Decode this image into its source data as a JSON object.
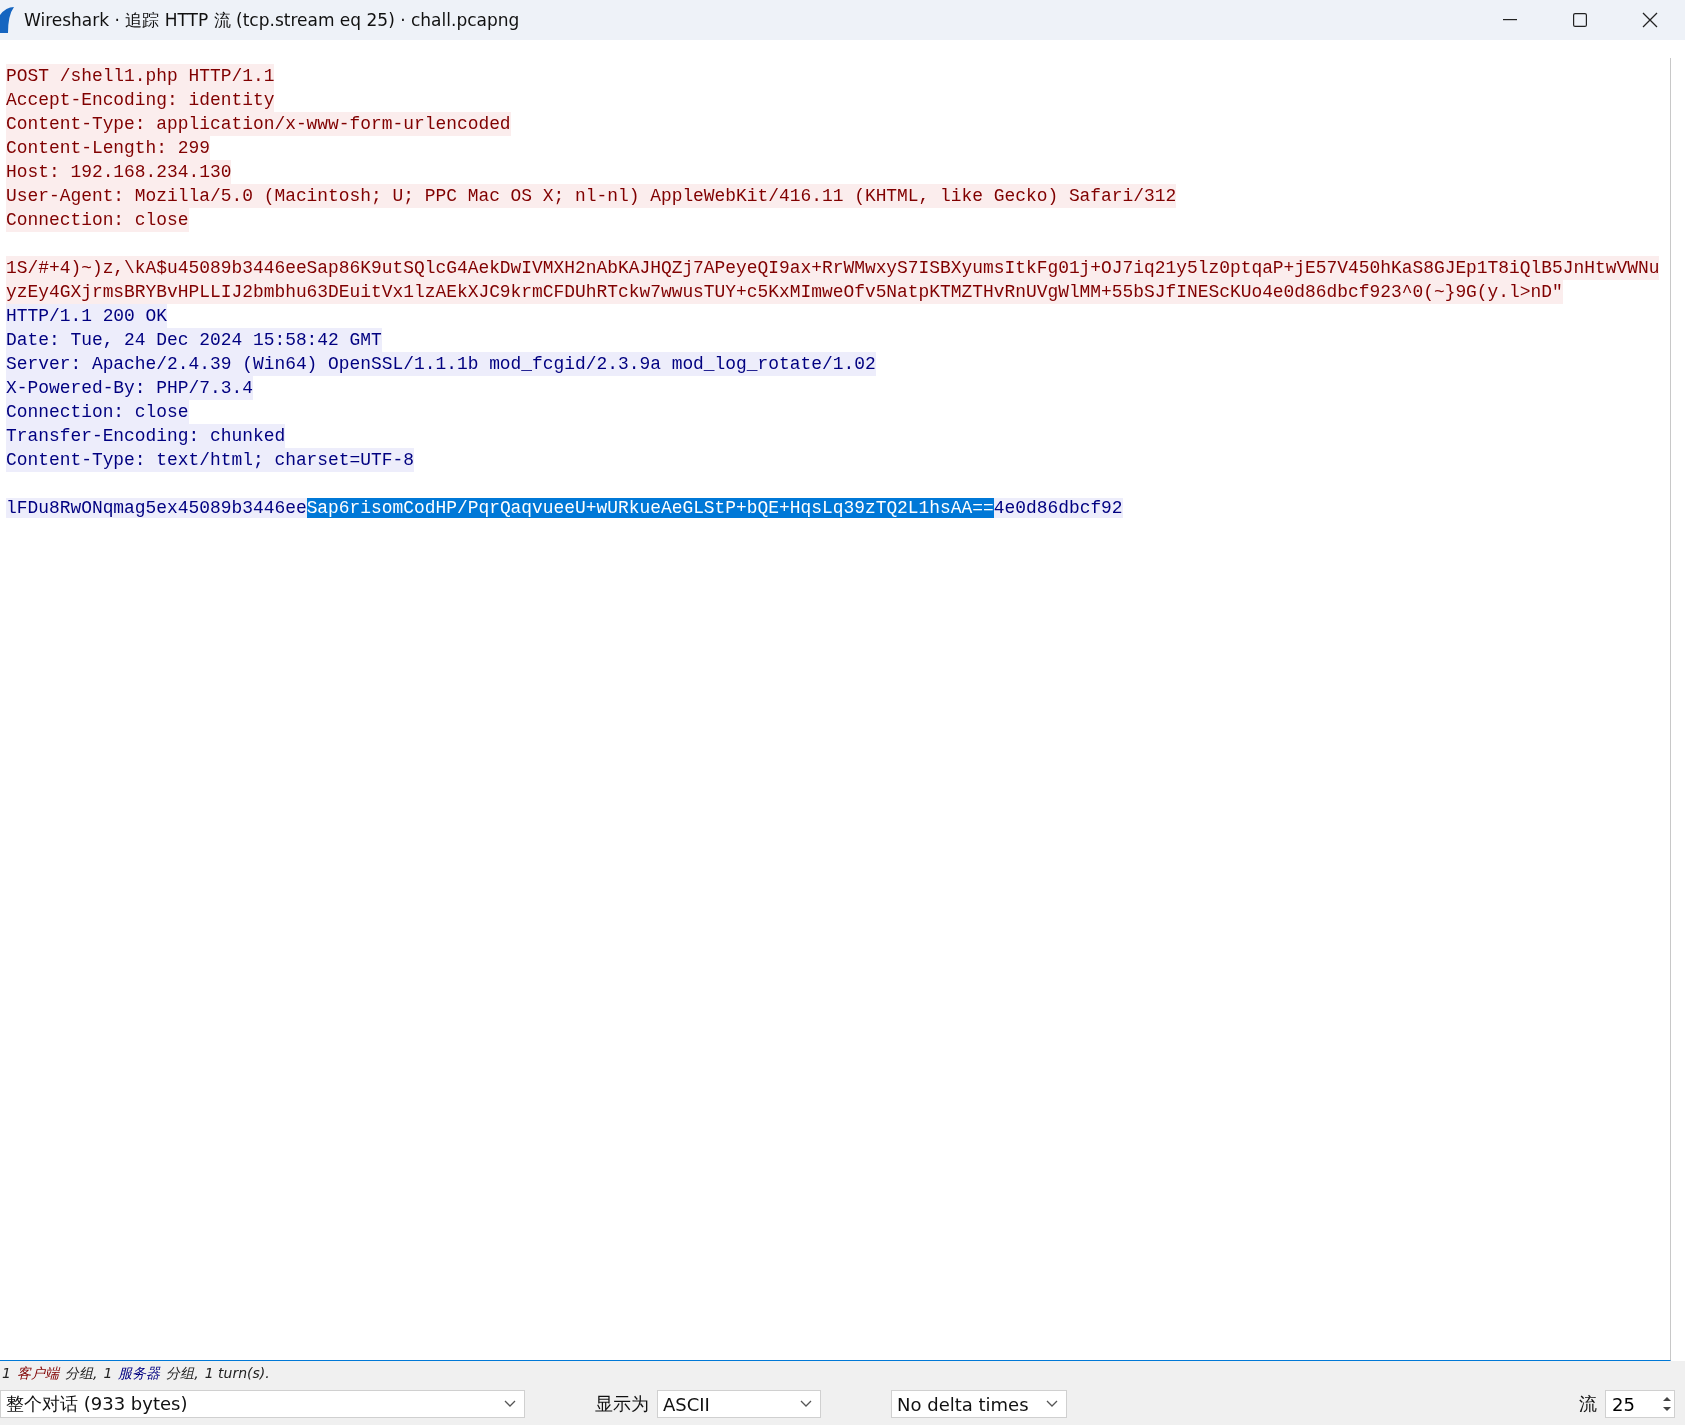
{
  "window": {
    "title": "Wireshark · 追踪 HTTP 流 (tcp.stream eq 25) · chall.pcapng"
  },
  "stream": {
    "lines": [
      {
        "kind": "text",
        "from_client": true,
        "text": "POST /shell1.php HTTP/1.1"
      },
      {
        "kind": "text",
        "from_client": true,
        "text": "Accept-Encoding: identity"
      },
      {
        "kind": "text",
        "from_client": true,
        "text": "Content-Type: application/x-www-form-urlencoded"
      },
      {
        "kind": "text",
        "from_client": true,
        "text": "Content-Length: 299"
      },
      {
        "kind": "text",
        "from_client": true,
        "text": "Host: 192.168.234.130"
      },
      {
        "kind": "text",
        "from_client": true,
        "text": "User-Agent: Mozilla/5.0 (Macintosh; U; PPC Mac OS X; nl-nl) AppleWebKit/416.11 (KHTML, like Gecko) Safari/312"
      },
      {
        "kind": "text",
        "from_client": true,
        "text": "Connection: close"
      },
      {
        "kind": "gap"
      },
      {
        "kind": "text",
        "from_client": true,
        "text": "1S/#+4)~)z,\\kA$u45089b3446eeSap86K9utSQlcG4AekDwIVMXH2nAbKAJHQZj7APeyeQI9ax+RrWMwxyS7ISBXyumsItkFg01j+OJ7iq21y5lz0ptqaP+jE57V450hKaS8GJEp1T8iQlB5JnHtwVWNu"
      },
      {
        "kind": "text",
        "from_client": true,
        "text": "yzEy4GXjrmsBRYBvHPLLIJ2bmbhu63DEuitVx1lzAEkXJC9krmCFDUhRTckw7wwusTUY+c5KxMImweOfv5NatpKTMZTHvRnUVgWlMM+55bSJfINEScKUo4e0d86dbcf923^0(~}9G(y.l>nD\""
      },
      {
        "kind": "text",
        "from_client": false,
        "text": "HTTP/1.1 200 OK"
      },
      {
        "kind": "text",
        "from_client": false,
        "text": "Date: Tue, 24 Dec 2024 15:58:42 GMT"
      },
      {
        "kind": "text",
        "from_client": false,
        "text": "Server: Apache/2.4.39 (Win64) OpenSSL/1.1.1b mod_fcgid/2.3.9a mod_log_rotate/1.02"
      },
      {
        "kind": "text",
        "from_client": false,
        "text": "X-Powered-By: PHP/7.3.4"
      },
      {
        "kind": "text",
        "from_client": false,
        "text": "Connection: close"
      },
      {
        "kind": "text",
        "from_client": false,
        "text": "Transfer-Encoding: chunked"
      },
      {
        "kind": "text",
        "from_client": false,
        "text": "Content-Type: text/html; charset=UTF-8"
      },
      {
        "kind": "gap"
      },
      {
        "kind": "parts",
        "from_client": false,
        "parts": [
          {
            "text": "lFDu8RwONqmag5ex45089b3446ee",
            "selected": false
          },
          {
            "text": "Sap6risomCodHP/PqrQaqvueeU+wURkueAeGLStP+bQE+HqsLq39zTQ2L1hsAA==",
            "selected": true
          },
          {
            "text": "4e0d86dbcf92",
            "selected": false
          }
        ]
      }
    ]
  },
  "summary": [
    {
      "text": "1"
    },
    {
      "text": "客户端",
      "from_client": true
    },
    {
      "text": "分组,"
    },
    {
      "text": "1"
    },
    {
      "text": "服务器",
      "from_client": false
    },
    {
      "text": "分组,"
    },
    {
      "text": "1 turn(s)."
    }
  ],
  "controls": {
    "conversation": "整个对话 (933 bytes)",
    "show_as_label": "显示为",
    "show_as": "ASCII",
    "delta": "No delta times",
    "stream_label": "流",
    "stream": "25"
  }
}
